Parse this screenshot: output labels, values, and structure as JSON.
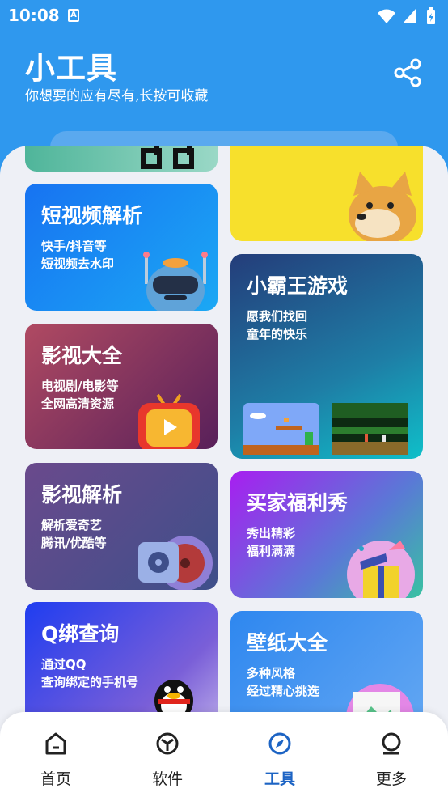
{
  "status_bar": {
    "time": "10:08",
    "notif_glyph": "A"
  },
  "header": {
    "title": "小工具",
    "subtitle": "你想要的应有尽有,长按可收藏",
    "share_icon": "share-icon"
  },
  "cards": {
    "short_video": {
      "title": "短视频解析",
      "line1": "快手/抖音等",
      "line2": "短视频去水印"
    },
    "movies": {
      "title": "影视大全",
      "line1": "电视剧/电影等",
      "line2": "全网高清资源"
    },
    "video_parse": {
      "title": "影视解析",
      "line1": "解析爱奇艺",
      "line2": "腾讯/优酷等"
    },
    "qq_lookup": {
      "title": "Q绑查询",
      "line1": "通过QQ",
      "line2": "查询绑定的手机号"
    },
    "nes_games": {
      "title": "小霸王游戏",
      "line1": "愿我们找回",
      "line2": "童年的快乐"
    },
    "buyer_show": {
      "title": "买家福利秀",
      "line1": "秀出精彩",
      "line2": "福利满满"
    },
    "wallpaper": {
      "title": "壁纸大全",
      "line1": "多种风格",
      "line2": "经过精心挑选"
    }
  },
  "bottom_nav": {
    "items": [
      {
        "label": "首页",
        "icon": "home-icon"
      },
      {
        "label": "软件",
        "icon": "box-icon"
      },
      {
        "label": "工具",
        "icon": "compass-icon"
      },
      {
        "label": "更多",
        "icon": "user-icon"
      }
    ],
    "active": "工具"
  },
  "colors": {
    "header_bg": "#2f98ee",
    "active_nav": "#1d64c4",
    "panel_bg": "#eef0f6"
  }
}
